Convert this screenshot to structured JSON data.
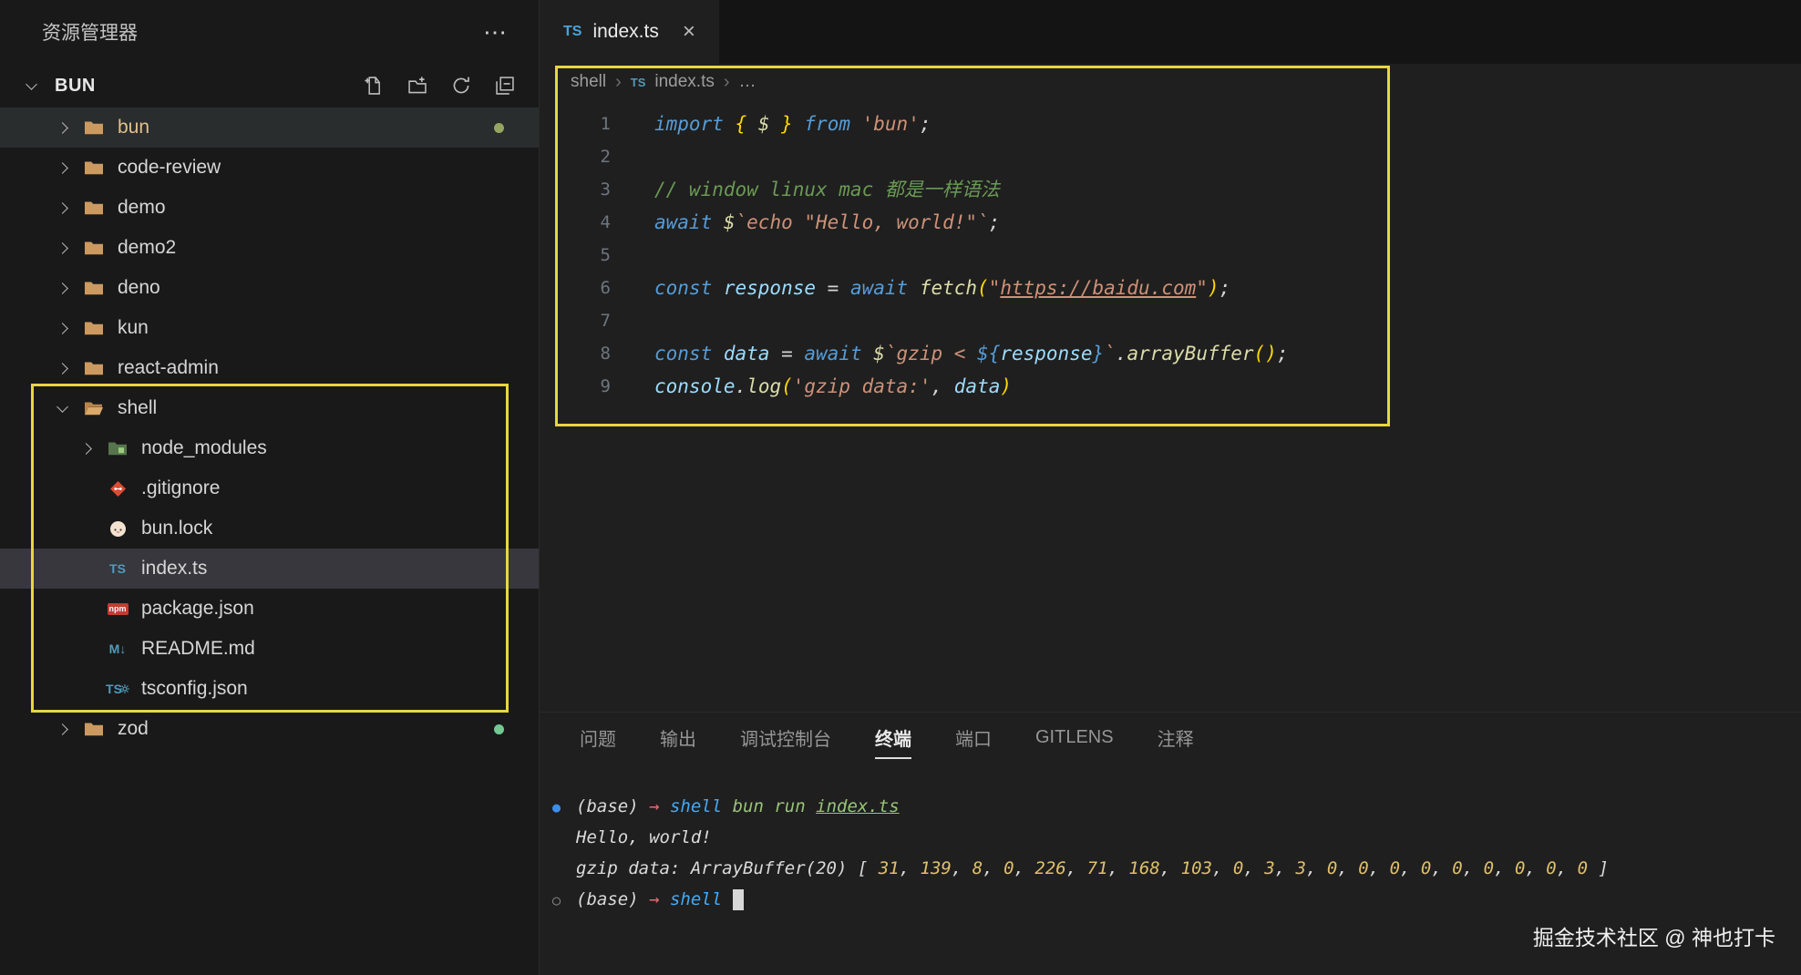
{
  "sidebar": {
    "title": "资源管理器",
    "more_label": "⋯",
    "section": "BUN",
    "toolbar_icons": [
      "new-file",
      "new-folder",
      "refresh",
      "collapse-all"
    ],
    "tree": [
      {
        "name": "bun",
        "type": "folder",
        "level": 0,
        "expanded": false,
        "icon": "folder",
        "label_color": "#e2c08d",
        "row_bg": "#2a2d2e",
        "dot": "#94a65f"
      },
      {
        "name": "code-review",
        "type": "folder",
        "level": 0,
        "expanded": false,
        "icon": "folder"
      },
      {
        "name": "demo",
        "type": "folder",
        "level": 0,
        "expanded": false,
        "icon": "folder"
      },
      {
        "name": "demo2",
        "type": "folder",
        "level": 0,
        "expanded": false,
        "icon": "folder"
      },
      {
        "name": "deno",
        "type": "folder",
        "level": 0,
        "expanded": false,
        "icon": "folder"
      },
      {
        "name": "kun",
        "type": "folder",
        "level": 0,
        "expanded": false,
        "icon": "folder"
      },
      {
        "name": "react-admin",
        "type": "folder",
        "level": 0,
        "expanded": false,
        "icon": "folder"
      },
      {
        "name": "shell",
        "type": "folder",
        "level": 0,
        "expanded": true,
        "icon": "folder-open"
      },
      {
        "name": "node_modules",
        "type": "folder",
        "level": 1,
        "expanded": false,
        "icon": "folder-node"
      },
      {
        "name": ".gitignore",
        "type": "file",
        "level": 1,
        "icon": "git"
      },
      {
        "name": "bun.lock",
        "type": "file",
        "level": 1,
        "icon": "bun"
      },
      {
        "name": "index.ts",
        "type": "file",
        "level": 1,
        "icon": "ts",
        "selected": true
      },
      {
        "name": "package.json",
        "type": "file",
        "level": 1,
        "icon": "npm"
      },
      {
        "name": "README.md",
        "type": "file",
        "level": 1,
        "icon": "md"
      },
      {
        "name": "tsconfig.json",
        "type": "file",
        "level": 1,
        "icon": "ts-gear"
      },
      {
        "name": "zod",
        "type": "folder",
        "level": 0,
        "expanded": false,
        "icon": "folder",
        "dot": "#73c991"
      }
    ]
  },
  "editor": {
    "tab": {
      "icon_text": "TS",
      "label": "index.ts",
      "close": "×"
    },
    "breadcrumb": {
      "separator": "›",
      "items": [
        {
          "label": "shell"
        },
        {
          "label": "index.ts",
          "icon": "TS"
        },
        {
          "label": "…"
        }
      ]
    },
    "code": {
      "lines": [
        {
          "num": "1",
          "tokens": [
            {
              "t": "import ",
              "c": "kw"
            },
            {
              "t": "{ ",
              "c": "gold"
            },
            {
              "t": "$",
              "c": "fn"
            },
            {
              "t": " }",
              "c": "gold"
            },
            {
              "t": " from ",
              "c": "kw"
            },
            {
              "t": "'bun'",
              "c": "str"
            },
            {
              "t": ";",
              "c": "punc"
            }
          ]
        },
        {
          "num": "2",
          "tokens": []
        },
        {
          "num": "3",
          "tokens": [
            {
              "t": "// window linux mac 都是一样语法",
              "c": "cmt"
            }
          ]
        },
        {
          "num": "4",
          "tokens": [
            {
              "t": "await ",
              "c": "kw"
            },
            {
              "t": "$",
              "c": "fn"
            },
            {
              "t": "`echo \"Hello, world!\"`",
              "c": "str"
            },
            {
              "t": ";",
              "c": "punc"
            }
          ]
        },
        {
          "num": "5",
          "tokens": []
        },
        {
          "num": "6",
          "tokens": [
            {
              "t": "const ",
              "c": "kw"
            },
            {
              "t": "response",
              "c": "var"
            },
            {
              "t": " = ",
              "c": "punc"
            },
            {
              "t": "await ",
              "c": "kw"
            },
            {
              "t": "fetch",
              "c": "fn"
            },
            {
              "t": "(",
              "c": "gold"
            },
            {
              "t": "\"",
              "c": "str"
            },
            {
              "t": "https://baidu.com",
              "c": "link"
            },
            {
              "t": "\"",
              "c": "str"
            },
            {
              "t": ")",
              "c": "gold"
            },
            {
              "t": ";",
              "c": "punc"
            }
          ]
        },
        {
          "num": "7",
          "tokens": []
        },
        {
          "num": "8",
          "tokens": [
            {
              "t": "const ",
              "c": "kw"
            },
            {
              "t": "data",
              "c": "var"
            },
            {
              "t": " = ",
              "c": "punc"
            },
            {
              "t": "await ",
              "c": "kw"
            },
            {
              "t": "$",
              "c": "fn"
            },
            {
              "t": "`gzip < ",
              "c": "str"
            },
            {
              "t": "${",
              "c": "interp"
            },
            {
              "t": "response",
              "c": "var"
            },
            {
              "t": "}",
              "c": "interp"
            },
            {
              "t": "`",
              "c": "str"
            },
            {
              "t": ".",
              "c": "punc"
            },
            {
              "t": "arrayBuffer",
              "c": "fn"
            },
            {
              "t": "()",
              "c": "gold"
            },
            {
              "t": ";",
              "c": "punc"
            }
          ]
        },
        {
          "num": "9",
          "tokens": [
            {
              "t": "console",
              "c": "var"
            },
            {
              "t": ".",
              "c": "punc"
            },
            {
              "t": "log",
              "c": "fn"
            },
            {
              "t": "(",
              "c": "gold"
            },
            {
              "t": "'gzip data:'",
              "c": "str"
            },
            {
              "t": ", ",
              "c": "punc"
            },
            {
              "t": "data",
              "c": "var"
            },
            {
              "t": ")",
              "c": "gold"
            }
          ]
        }
      ]
    }
  },
  "panel": {
    "tabs": [
      {
        "label": "问题"
      },
      {
        "label": "输出"
      },
      {
        "label": "调试控制台"
      },
      {
        "label": "终端",
        "active": true
      },
      {
        "label": "端口"
      },
      {
        "label": "GITLENS"
      },
      {
        "label": "注释"
      }
    ],
    "terminal": {
      "lines": [
        {
          "tokens": [
            {
              "t": "●",
              "c": "dotblue"
            },
            {
              "t": "(base) ",
              "c": "plain"
            },
            {
              "t": "→ ",
              "c": "arrow"
            },
            {
              "t": "shell ",
              "c": "dir"
            },
            {
              "t": "bun run ",
              "c": "cmd"
            },
            {
              "t": "index.ts",
              "c": "cmd ul"
            }
          ]
        },
        {
          "tokens": [
            {
              "t": "Hello, world!",
              "c": "plain"
            }
          ]
        },
        {
          "tokens": [
            {
              "t": "gzip data: ArrayBuffer(20) [ ",
              "c": "plain"
            },
            {
              "t": "31",
              "c": "num"
            },
            {
              "t": ", ",
              "c": "plain"
            },
            {
              "t": "139",
              "c": "num"
            },
            {
              "t": ", ",
              "c": "plain"
            },
            {
              "t": "8",
              "c": "num"
            },
            {
              "t": ", ",
              "c": "plain"
            },
            {
              "t": "0",
              "c": "num"
            },
            {
              "t": ", ",
              "c": "plain"
            },
            {
              "t": "226",
              "c": "num"
            },
            {
              "t": ", ",
              "c": "plain"
            },
            {
              "t": "71",
              "c": "num"
            },
            {
              "t": ", ",
              "c": "plain"
            },
            {
              "t": "168",
              "c": "num"
            },
            {
              "t": ", ",
              "c": "plain"
            },
            {
              "t": "103",
              "c": "num"
            },
            {
              "t": ", ",
              "c": "plain"
            },
            {
              "t": "0",
              "c": "num"
            },
            {
              "t": ", ",
              "c": "plain"
            },
            {
              "t": "3",
              "c": "num"
            },
            {
              "t": ", ",
              "c": "plain"
            },
            {
              "t": "3",
              "c": "num"
            },
            {
              "t": ", ",
              "c": "plain"
            },
            {
              "t": "0",
              "c": "num"
            },
            {
              "t": ", ",
              "c": "plain"
            },
            {
              "t": "0",
              "c": "num"
            },
            {
              "t": ", ",
              "c": "plain"
            },
            {
              "t": "0",
              "c": "num"
            },
            {
              "t": ", ",
              "c": "plain"
            },
            {
              "t": "0",
              "c": "num"
            },
            {
              "t": ", ",
              "c": "plain"
            },
            {
              "t": "0",
              "c": "num"
            },
            {
              "t": ", ",
              "c": "plain"
            },
            {
              "t": "0",
              "c": "num"
            },
            {
              "t": ", ",
              "c": "plain"
            },
            {
              "t": "0",
              "c": "num"
            },
            {
              "t": ", ",
              "c": "plain"
            },
            {
              "t": "0",
              "c": "num"
            },
            {
              "t": ", ",
              "c": "plain"
            },
            {
              "t": "0",
              "c": "num"
            },
            {
              "t": " ]",
              "c": "plain"
            }
          ]
        },
        {
          "tokens": [
            {
              "t": "○",
              "c": "hollow"
            },
            {
              "t": "(base) ",
              "c": "plain"
            },
            {
              "t": "→ ",
              "c": "arrow"
            },
            {
              "t": "shell ",
              "c": "dir"
            },
            {
              "t": "",
              "c": "cursor"
            }
          ]
        }
      ]
    }
  },
  "watermark": "掘金技术社区 @ 神也打卡",
  "annotations": {
    "color": "#e8d63f"
  }
}
